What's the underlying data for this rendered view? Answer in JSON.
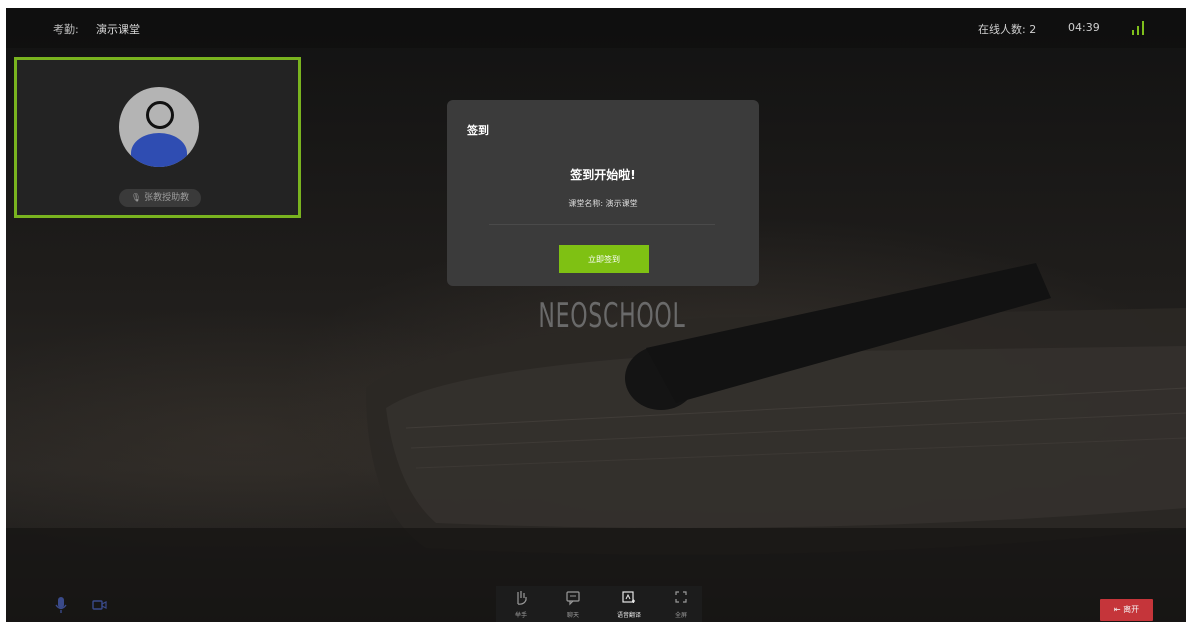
{
  "topbar": {
    "attendance_label": "考勤:",
    "class_name": "演示课堂",
    "online_count": "在线人数: 2",
    "timer": "04:39",
    "signal_icon": "signal-strength-icon"
  },
  "participant": {
    "name": "张教授助教",
    "mic_icon": "mic-icon",
    "avatar_icon": "user-avatar-icon",
    "highlight_color": "#79b31f"
  },
  "brand": {
    "logo_text": "NEOSCHOOL"
  },
  "modal": {
    "title": "签到",
    "heading": "签到开始啦!",
    "class_line": "课堂名称: 演示课堂",
    "button_label": "立即签到",
    "button_color": "#7fc113"
  },
  "bottom": {
    "mic_icon": "microphone-icon",
    "camera_icon": "camera-icon",
    "tools": [
      {
        "label": "举手",
        "icon": "raise-hand-icon"
      },
      {
        "label": "聊天",
        "icon": "chat-icon"
      },
      {
        "label": "语音翻译",
        "icon": "voice-translate-icon"
      },
      {
        "label": "全屏",
        "icon": "fullscreen-icon"
      }
    ],
    "leave_label": "离开",
    "leave_icon": "exit-icon",
    "leave_color": "#c5353a"
  }
}
